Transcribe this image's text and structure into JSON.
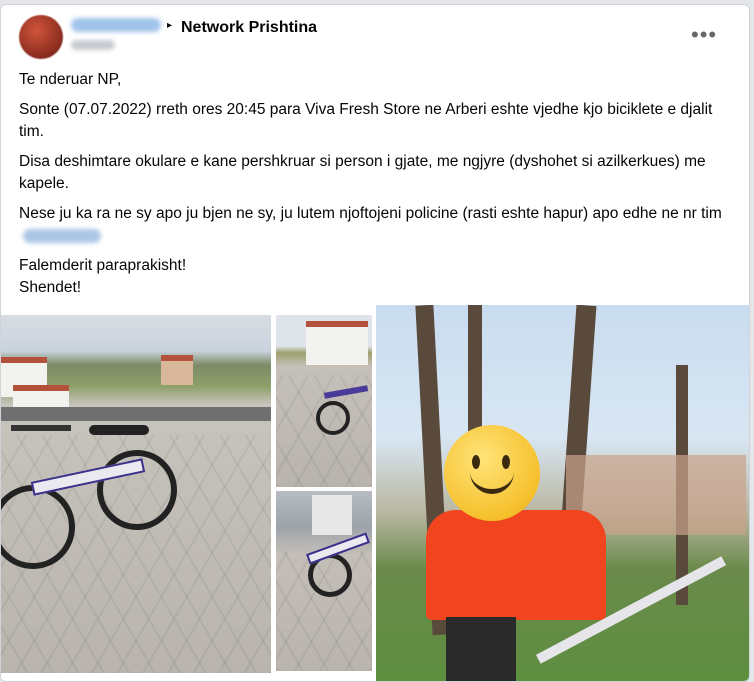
{
  "post": {
    "group_name": "Network Prishtina",
    "more_options": "•••",
    "paragraphs": {
      "greeting": "Te nderuar NP,",
      "p1": "Sonte (07.07.2022) rreth ores 20:45 para Viva Fresh Store ne Arberi eshte vjedhe kjo biciklete e djalit tim.",
      "p2": "Disa deshimtare okulare e kane pershkruar si person i gjate, me ngjyre (dyshohet si azilkerkues) me kapele.",
      "p3": "Nese ju ka ra ne sy apo ju bjen ne sy, ju lutem njoftojeni policine (rasti eshte hapur) apo edhe ne nr tim",
      "p4_line1": "Falemderit paraprakisht!",
      "p4_line2": "Shendet!"
    }
  },
  "icons": {
    "arrow": "▸",
    "more": "more-icon"
  },
  "colors": {
    "group_name": "#050505",
    "background": "#e4e6ea",
    "jacket": "#f0451e",
    "emoji": "#f6c02c"
  }
}
